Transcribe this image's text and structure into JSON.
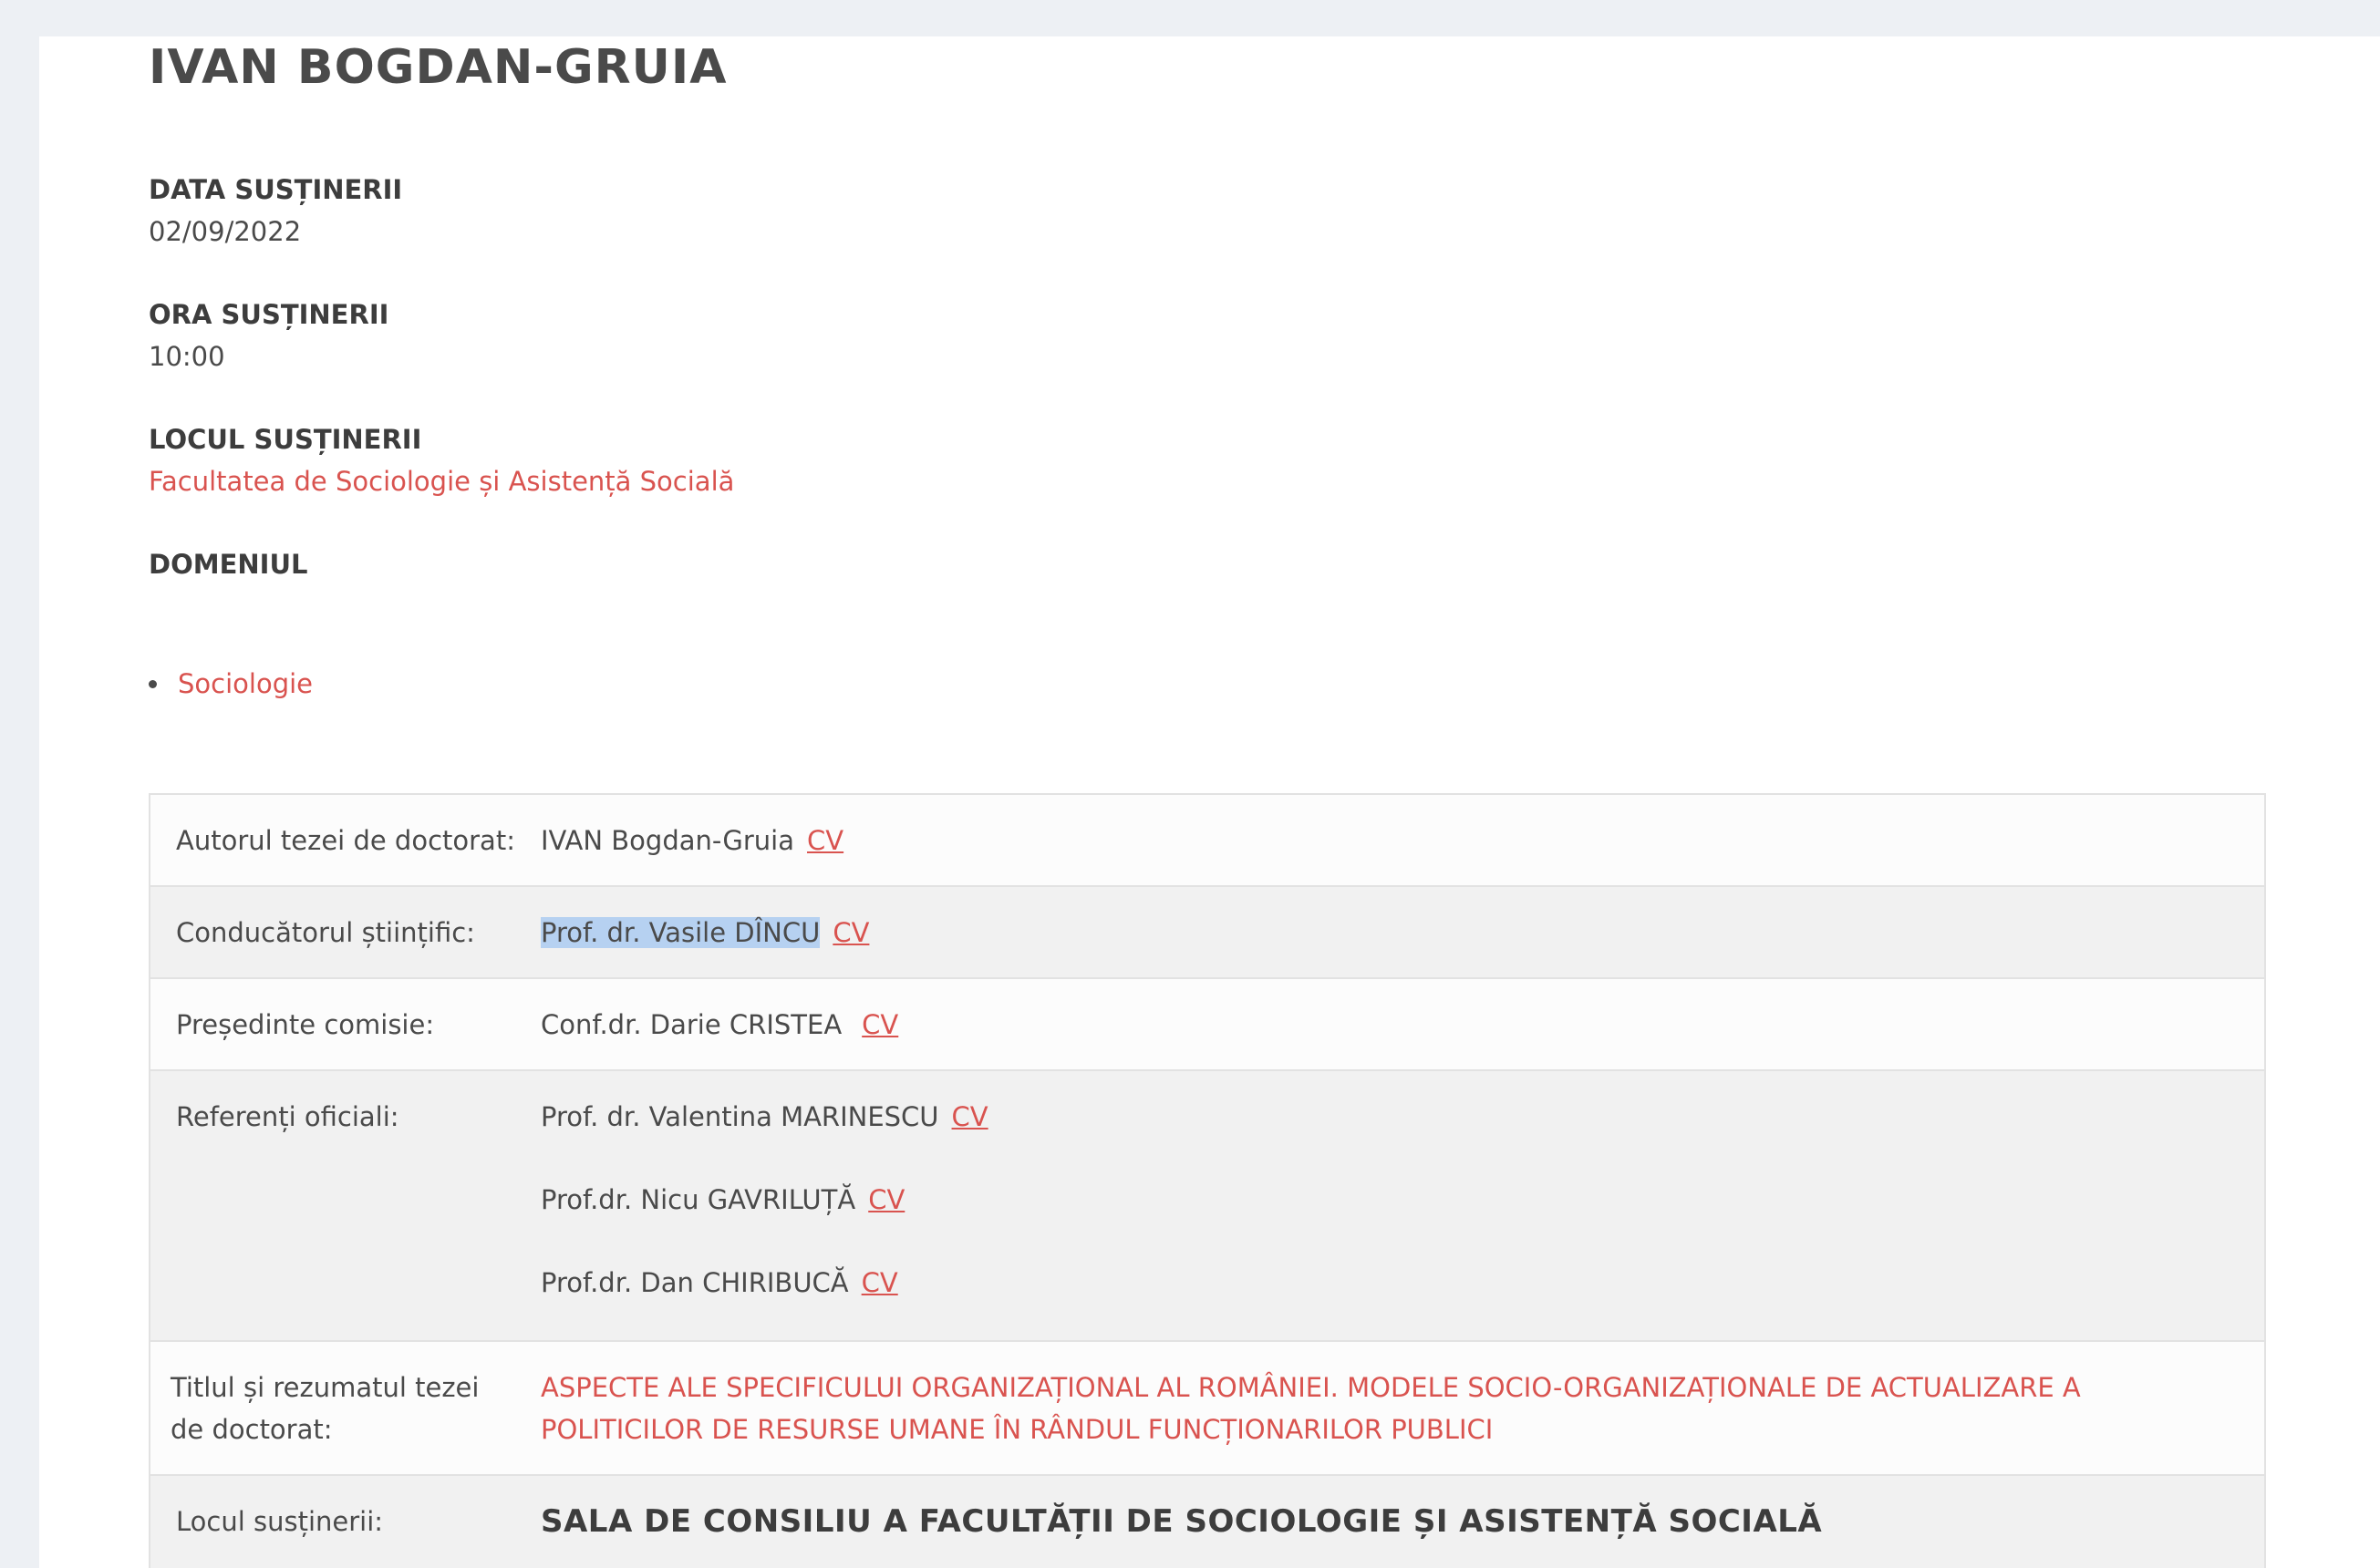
{
  "page": {
    "title": "IVAN BOGDAN-GRUIA"
  },
  "fields": {
    "date_label": "DATA SUSȚINERII",
    "date_value": "02/09/2022",
    "time_label": "ORA SUSȚINERII",
    "time_value": "10:00",
    "place_label": "LOCUL SUSȚINERII",
    "place_value": "Facultatea de Sociologie și Asistență Socială",
    "domain_label": "DOMENIUL",
    "domains": [
      "Sociologie"
    ]
  },
  "table": {
    "author_label": "Autorul tezei de doctorat:",
    "author_name": "IVAN Bogdan-Gruia",
    "supervisor_label": "Conducătorul științific:",
    "supervisor_name": "Prof. dr. Vasile DÎNCU",
    "president_label": "Președinte comisie:",
    "president_name": "Conf.dr. Darie CRISTEA",
    "referees_label": "Referenți oficiali:",
    "referees": [
      "Prof. dr. Valentina MARINESCU",
      "Prof.dr. Nicu GAVRILUȚĂ",
      "Prof.dr. Dan CHIRIBUCĂ"
    ],
    "thesis_label": "Titlul și rezumatul tezei de doctorat:",
    "thesis_title": "ASPECTE ALE SPECIFICULUI ORGANIZAȚIONAL AL ROMÂNIEI. MODELE SOCIO-ORGANIZAȚIONALE DE ACTUALIZARE A POLITICILOR DE RESURSE UMANE ÎN RÂNDUL FUNCȚIONARILOR PUBLICI",
    "venue_label": "Locul susținerii:",
    "venue_value": "SALA DE CONSILIU A FACULTĂȚII DE SOCIOLOGIE ȘI ASISTENȚĂ SOCIALĂ",
    "cv_label": "CV"
  },
  "colors": {
    "link": "#d9534f",
    "background": "#edf0f4",
    "row_grey": "#f1f1f1",
    "selection": "#b6d1f1"
  }
}
